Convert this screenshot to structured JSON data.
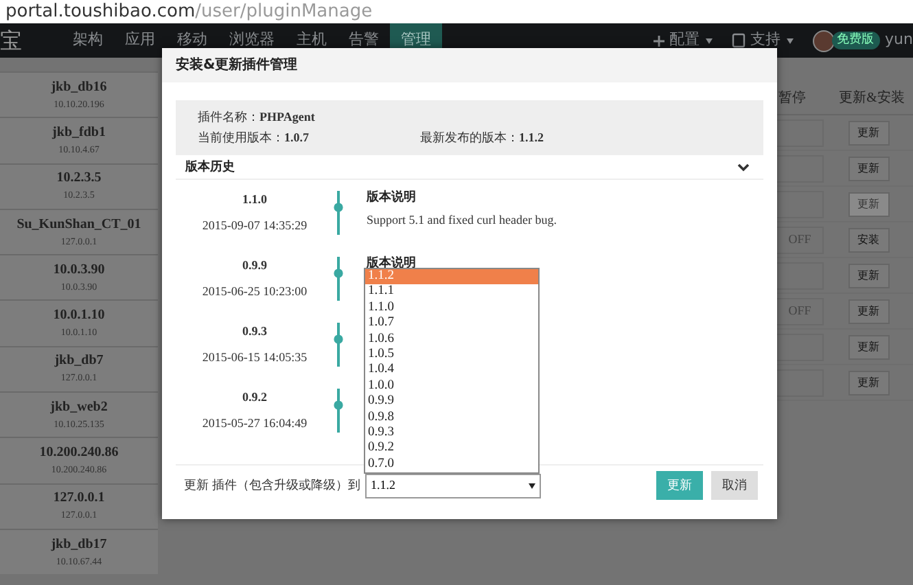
{
  "address_bar": {
    "host": "portal.toushibao.com",
    "path": "/user/pluginManage"
  },
  "navbar": {
    "logo": "宝",
    "items": [
      {
        "label": "架构",
        "selected": false
      },
      {
        "label": "应用",
        "selected": false
      },
      {
        "label": "移动",
        "selected": false
      },
      {
        "label": "浏览器",
        "selected": false
      },
      {
        "label": "主机",
        "selected": false
      },
      {
        "label": "告警",
        "selected": false
      },
      {
        "label": "管理",
        "selected": true
      }
    ],
    "config_menu": "配置",
    "support_menu": "支持",
    "plan_badge": "免费版",
    "user": "yun"
  },
  "hosts": [
    {
      "name": "jkb_db16",
      "ip": "10.10.20.196"
    },
    {
      "name": "jkb_fdb1",
      "ip": "10.10.4.67"
    },
    {
      "name": "10.2.3.5",
      "ip": "10.2.3.5"
    },
    {
      "name": "Su_KunShan_CT_01",
      "ip": "127.0.0.1"
    },
    {
      "name": "10.0.3.90",
      "ip": "10.0.3.90"
    },
    {
      "name": "10.0.1.10",
      "ip": "10.0.1.10"
    },
    {
      "name": "jkb_db7",
      "ip": "127.0.0.1"
    },
    {
      "name": "jkb_web2",
      "ip": "10.10.25.135"
    },
    {
      "name": "10.200.240.86",
      "ip": "10.200.240.86"
    },
    {
      "name": "127.0.0.1",
      "ip": "127.0.0.1"
    },
    {
      "name": "jkb_db17",
      "ip": "10.10.67.44"
    }
  ],
  "table": {
    "columns": [
      "暂停",
      "更新&安装"
    ],
    "rows": [
      {
        "pause": "",
        "action": "更新",
        "disabled": false
      },
      {
        "pause": "",
        "action": "更新",
        "disabled": false
      },
      {
        "pause": "",
        "action": "更新",
        "disabled": true
      },
      {
        "pause": "OFF",
        "action": "安装",
        "disabled": false
      },
      {
        "pause": "",
        "action": "更新",
        "disabled": false
      },
      {
        "pause": "OFF",
        "action": "更新",
        "disabled": false
      },
      {
        "pause": "",
        "action": "更新",
        "disabled": false
      },
      {
        "pause": "",
        "action": "更新",
        "disabled": false
      }
    ]
  },
  "dialog": {
    "title": "安装&更新插件管理",
    "plugin_name_label": "插件名称：",
    "plugin_name": "PHPAgent",
    "current_version_label": "当前使用版本：",
    "current_version": "1.0.7",
    "latest_version_label": "最新发布的版本：",
    "latest_version": "1.1.2",
    "history_title": "版本历史",
    "history": [
      {
        "version": "1.1.0",
        "date": "2015-09-07 14:35:29",
        "note_title": "版本说明",
        "note": "Support 5.1 and fixed curl header bug."
      },
      {
        "version": "0.9.9",
        "date": "2015-06-25 10:23:00",
        "note_title": "版本说明"
      },
      {
        "version": "0.9.3",
        "date": "2015-06-15 14:05:35"
      },
      {
        "version": "0.9.2",
        "date": "2015-05-27 16:04:49"
      }
    ],
    "update_label": "更新 插件（包含升级或降级）到",
    "select_value": "1.1.2",
    "options": [
      {
        "label": "1.1.2",
        "selected": true
      },
      {
        "label": "1.1.1",
        "selected": false
      },
      {
        "label": "1.1.0",
        "selected": false
      },
      {
        "label": "1.0.7",
        "selected": false
      },
      {
        "label": "1.0.6",
        "selected": false
      },
      {
        "label": "1.0.5",
        "selected": false
      },
      {
        "label": "1.0.4",
        "selected": false
      },
      {
        "label": "1.0.0",
        "selected": false
      },
      {
        "label": "0.9.9",
        "selected": false
      },
      {
        "label": "0.9.8",
        "selected": false
      },
      {
        "label": "0.9.3",
        "selected": false
      },
      {
        "label": "0.9.2",
        "selected": false
      },
      {
        "label": "0.7.0",
        "selected": false
      }
    ],
    "buttons": [
      "更新",
      "取消"
    ]
  }
}
